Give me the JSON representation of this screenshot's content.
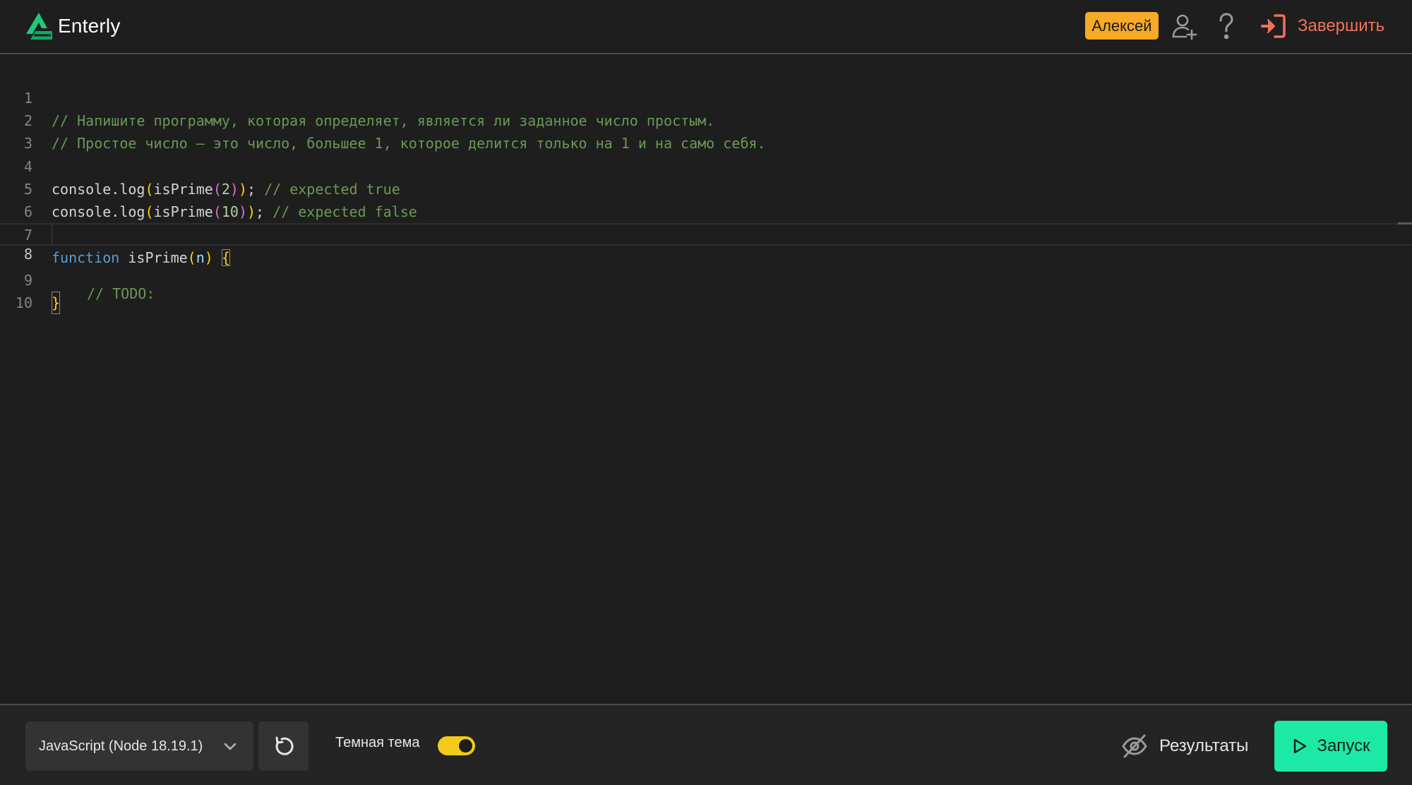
{
  "header": {
    "app_name": "Enterly",
    "user_name": "Алексей",
    "finish_label": "Завершить",
    "icons": {
      "logo": "enterly-logo-icon",
      "add_user": "add-user-icon",
      "help": "question-mark-icon",
      "finish": "exit-icon"
    }
  },
  "editor": {
    "line_numbers": [
      "1",
      "2",
      "3",
      "4",
      "5",
      "6",
      "7",
      "8",
      "9",
      "10"
    ],
    "current_line": "8",
    "code_text": {
      "l1": "// Напишите программу, которая определяет, является ли заданное число простым.",
      "l2": "// Простое число — это число, большее 1, которое делится только на 1 и на само себя.",
      "l4_obj": "console",
      "l4_method": ".log",
      "l4_open1": "(",
      "l4_fn": "isPrime",
      "l4_open2": "(",
      "l4_arg": "2",
      "l4_close2": ")",
      "l4_close1": ")",
      "l4_semi": "; ",
      "l4_comment": "// expected true",
      "l5_obj": "console",
      "l5_method": ".log",
      "l5_open1": "(",
      "l5_fn": "isPrime",
      "l5_open2": "(",
      "l5_arg": "10",
      "l5_close2": ")",
      "l5_close1": ")",
      "l5_semi": "; ",
      "l5_comment": "// expected false",
      "l7_kw": "function",
      "l7_name": " isPrime",
      "l7_open": "(",
      "l7_param": "n",
      "l7_close": ")",
      "l7_space": " ",
      "l7_brace": "{",
      "l8_comment": "// TODO:",
      "l9_brace": "}"
    }
  },
  "footer": {
    "language_selected": "JavaScript (Node 18.19.1)",
    "theme_label": "Темная тема",
    "dark_theme_on": true,
    "results_label": "Результаты",
    "run_label": "Запуск",
    "icons": {
      "dropdown": "chevron-down-icon",
      "reset": "reset-icon",
      "results": "eye-off-icon",
      "run": "play-icon"
    }
  },
  "colors": {
    "background": "#1e1e1e",
    "accent_green": "#1de9a6",
    "user_badge": "#f7a928",
    "finish_red": "#f0725a",
    "toggle_yellow": "#f2cc18",
    "comment_green": "#6a9955",
    "keyword_blue": "#569cd6"
  }
}
